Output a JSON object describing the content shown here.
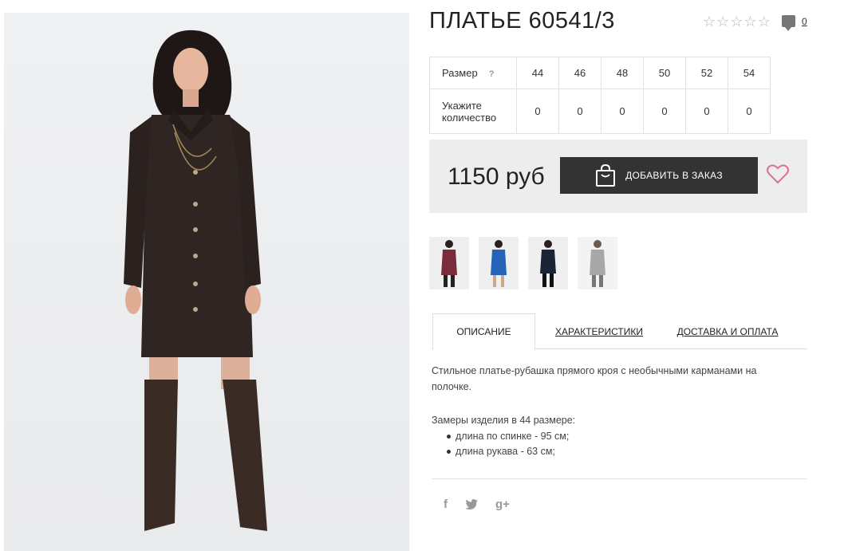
{
  "product": {
    "title": "ПЛАТЬЕ 60541/3",
    "rating_stars": 5,
    "rating_value": 0,
    "comments_count": "0"
  },
  "icons": {
    "star": "star-outline-icon",
    "comment": "comment-bubble-icon",
    "bag": "shopping-bag-icon",
    "heart": "heart-outline-icon",
    "help": "question-icon"
  },
  "size_table": {
    "size_label": "Размер",
    "help_mark": "?",
    "qty_label": "Укажите количество",
    "sizes": [
      "44",
      "46",
      "48",
      "50",
      "52",
      "54"
    ],
    "quantities": [
      "0",
      "0",
      "0",
      "0",
      "0",
      "0"
    ]
  },
  "buy": {
    "price": "1150 руб",
    "add_button": "ДОБАВИТЬ В ЗАКАЗ"
  },
  "thumbnails": [
    {
      "name": "variant-burgundy",
      "color": "#7a2c3a"
    },
    {
      "name": "variant-blue",
      "color": "#2463b8"
    },
    {
      "name": "variant-navy",
      "color": "#1b2336"
    },
    {
      "name": "variant-grey",
      "color": "#a8a8a8"
    }
  ],
  "tabs": {
    "description": "ОПИСАНИЕ",
    "characteristics": "ХАРАКТЕРИСТИКИ",
    "delivery": "ДОСТАВКА И ОПЛАТА"
  },
  "description": {
    "text": "Стильное платье-рубашка прямого кроя с необычными карманами на полочке.",
    "measures_title": "Замеры изделия в 44 размере:",
    "measures": [
      "длина по спинке - 95 см;",
      "длина рукава - 63 см;"
    ]
  },
  "social": {
    "facebook": "f",
    "twitter": "twitter",
    "googleplus": "g+"
  },
  "colors": {
    "dress": "#2f2624",
    "button_bg": "#333333",
    "heart": "#d9738e",
    "panel_bg": "#ededed"
  }
}
